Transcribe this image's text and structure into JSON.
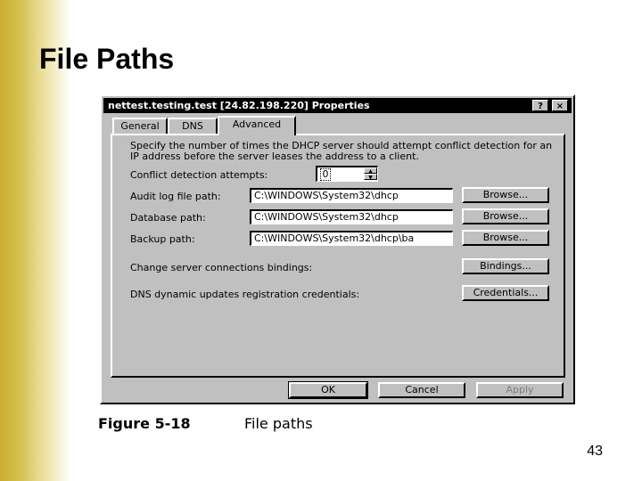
{
  "slide": {
    "title": "File Paths",
    "page_number": "43",
    "caption_figure": "Figure 5-18",
    "caption_text": "File paths"
  },
  "dialog": {
    "title": "nettest.testing.test [24.82.198.220] Properties",
    "help_button": "?",
    "close_button": "×",
    "tabs": [
      {
        "label": "General",
        "active": false
      },
      {
        "label": "DNS",
        "active": false
      },
      {
        "label": "Advanced",
        "active": true
      }
    ],
    "description": "Specify the number of times the DHCP server should attempt conflict detection for an IP address before the server leases the address to a client.",
    "conflict_label": "Conflict detection attempts:",
    "conflict_value": "0",
    "audit_label": "Audit log file path:",
    "audit_value": "C:\\WINDOWS\\System32\\dhcp",
    "database_label": "Database path:",
    "database_value": "C:\\WINDOWS\\System32\\dhcp",
    "backup_label": "Backup path:",
    "backup_value": "C:\\WINDOWS\\System32\\dhcp\\ba",
    "browse_label": "Browse...",
    "bindings_text": "Change server connections bindings:",
    "bindings_button": "Bindings...",
    "credentials_text": "DNS dynamic updates registration credentials:",
    "credentials_button": "Credentials...",
    "ok_button": "OK",
    "cancel_button": "Cancel",
    "apply_button": "Apply"
  },
  "colors": {
    "accent_bar": "#c9ae2c",
    "dialog_face": "#c0c0c0",
    "titlebar": "#000000"
  }
}
